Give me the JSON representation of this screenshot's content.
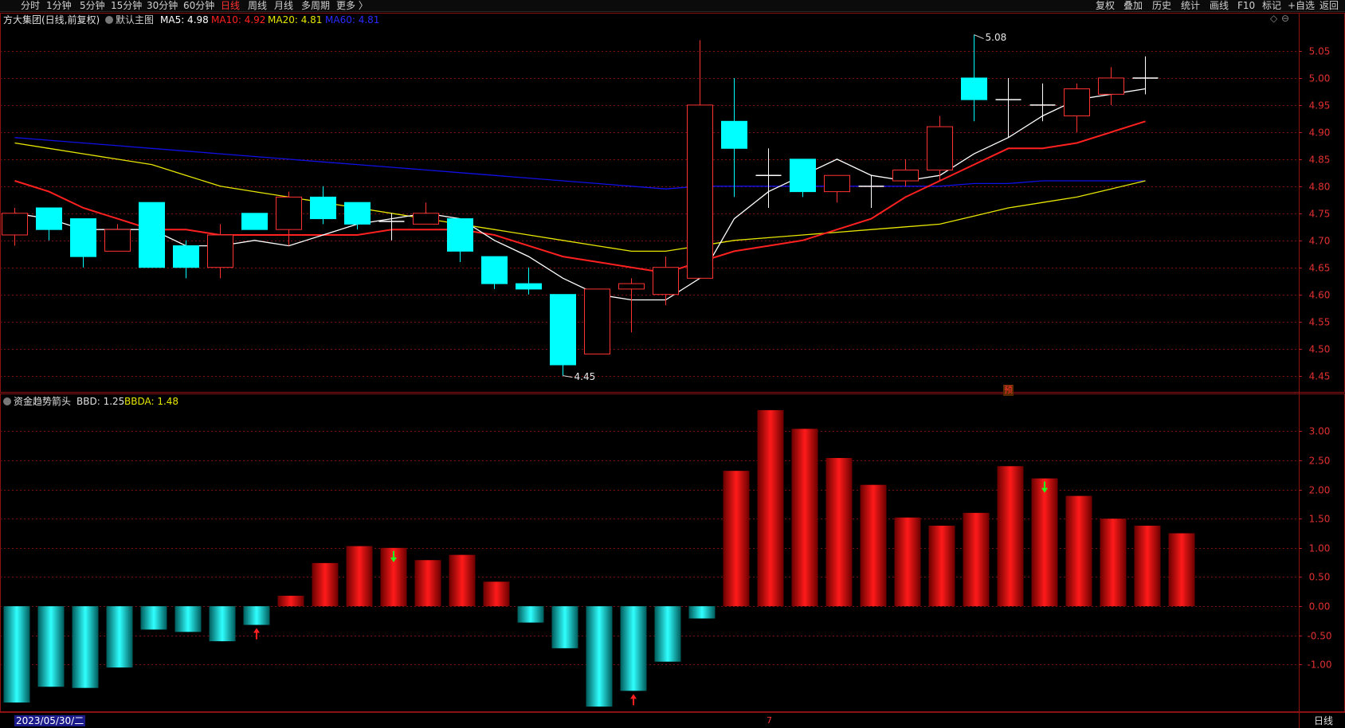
{
  "toolbar": {
    "periods": [
      "分时",
      "1分钟",
      "5分钟",
      "15分钟",
      "30分钟",
      "60分钟",
      "日线",
      "周线",
      "月线",
      "多周期",
      "更多 〉"
    ],
    "active_period": "日线",
    "right_items": [
      "复权",
      "叠加",
      "历史",
      "统计",
      "画线",
      "F10",
      "标记",
      "+自选",
      "返回"
    ]
  },
  "main_panel": {
    "stock_title": "方大集团(日线,前复权)",
    "template_label": "默认主图",
    "ma5_label": "MA5: 4.98",
    "ma10_label": "MA10: 4.92",
    "ma20_label": "MA20: 4.81",
    "ma60_label": "MA60: 4.81",
    "high_marker": "5.08",
    "low_marker": "4.45",
    "pre_marker": "预"
  },
  "sub_panel": {
    "indicator_name": "资金趋势箭头",
    "bbd_label": "BBD: 1.25",
    "bbda_label": "BBDA: 1.48"
  },
  "status": {
    "date_label": "2023/05/30/二",
    "month_marker": "7",
    "period_label": "日线"
  },
  "colors": {
    "up": "#ff3232",
    "down": "#00ffff",
    "ma5": "#ffffff",
    "ma10": "#ff2020",
    "ma20": "#e6e600",
    "ma60": "#1010e6",
    "grid": "#7a1010",
    "bar_up": "#e00000",
    "bar_down": "#00c8c8"
  },
  "chart_data": [
    {
      "type": "candlestick",
      "y_ticks": [
        "5.05",
        "5.00",
        "4.95",
        "4.90",
        "4.85",
        "4.80",
        "4.75",
        "4.70",
        "4.65",
        "4.60",
        "4.55",
        "4.50",
        "4.45"
      ],
      "ylim": [
        4.42,
        5.1
      ],
      "candles": [
        {
          "o": 4.71,
          "c": 4.75,
          "h": 4.76,
          "l": 4.69
        },
        {
          "o": 4.76,
          "c": 4.72,
          "h": 4.76,
          "l": 4.7
        },
        {
          "o": 4.74,
          "c": 4.67,
          "h": 4.74,
          "l": 4.65
        },
        {
          "o": 4.68,
          "c": 4.72,
          "h": 4.73,
          "l": 4.68
        },
        {
          "o": 4.77,
          "c": 4.65,
          "h": 4.77,
          "l": 4.65
        },
        {
          "o": 4.69,
          "c": 4.65,
          "h": 4.7,
          "l": 4.63
        },
        {
          "o": 4.65,
          "c": 4.71,
          "h": 4.73,
          "l": 4.63
        },
        {
          "o": 4.75,
          "c": 4.72,
          "h": 4.75,
          "l": 4.72
        },
        {
          "o": 4.72,
          "c": 4.78,
          "h": 4.79,
          "l": 4.69
        },
        {
          "o": 4.78,
          "c": 4.74,
          "h": 4.8,
          "l": 4.73
        },
        {
          "o": 4.77,
          "c": 4.73,
          "h": 4.77,
          "l": 4.72
        },
        {
          "o": 4.735,
          "c": 4.735,
          "h": 4.75,
          "l": 4.7
        },
        {
          "o": 4.73,
          "c": 4.75,
          "h": 4.77,
          "l": 4.73
        },
        {
          "o": 4.74,
          "c": 4.68,
          "h": 4.74,
          "l": 4.66
        },
        {
          "o": 4.67,
          "c": 4.62,
          "h": 4.67,
          "l": 4.61
        },
        {
          "o": 4.62,
          "c": 4.61,
          "h": 4.65,
          "l": 4.6
        },
        {
          "o": 4.6,
          "c": 4.47,
          "h": 4.6,
          "l": 4.45
        },
        {
          "o": 4.49,
          "c": 4.61,
          "h": 4.61,
          "l": 4.49
        },
        {
          "o": 4.61,
          "c": 4.62,
          "h": 4.63,
          "l": 4.53
        },
        {
          "o": 4.6,
          "c": 4.65,
          "h": 4.67,
          "l": 4.58
        },
        {
          "o": 4.63,
          "c": 4.95,
          "h": 5.07,
          "l": 4.63
        },
        {
          "o": 4.92,
          "c": 4.87,
          "h": 5.0,
          "l": 4.78
        },
        {
          "o": 4.82,
          "c": 4.82,
          "h": 4.87,
          "l": 4.76
        },
        {
          "o": 4.85,
          "c": 4.79,
          "h": 4.85,
          "l": 4.78
        },
        {
          "o": 4.79,
          "c": 4.82,
          "h": 4.82,
          "l": 4.77
        },
        {
          "o": 4.8,
          "c": 4.8,
          "h": 4.82,
          "l": 4.76
        },
        {
          "o": 4.81,
          "c": 4.83,
          "h": 4.85,
          "l": 4.8
        },
        {
          "o": 4.83,
          "c": 4.91,
          "h": 4.93,
          "l": 4.81
        },
        {
          "o": 5.0,
          "c": 4.96,
          "h": 5.08,
          "l": 4.92
        },
        {
          "o": 4.96,
          "c": 4.96,
          "h": 5.0,
          "l": 4.89
        },
        {
          "o": 4.95,
          "c": 4.95,
          "h": 4.99,
          "l": 4.92
        },
        {
          "o": 4.93,
          "c": 4.98,
          "h": 4.99,
          "l": 4.9
        },
        {
          "o": 4.97,
          "c": 5.0,
          "h": 5.02,
          "l": 4.95
        },
        {
          "o": 5.0,
          "c": 5.0,
          "h": 5.04,
          "l": 4.97
        }
      ],
      "ma5": [
        4.75,
        4.74,
        4.72,
        4.72,
        4.72,
        4.69,
        4.69,
        4.7,
        4.69,
        4.71,
        4.73,
        4.74,
        4.75,
        4.74,
        4.7,
        4.67,
        4.63,
        4.6,
        4.59,
        4.59,
        4.63,
        4.74,
        4.79,
        4.82,
        4.85,
        4.82,
        4.81,
        4.82,
        4.86,
        4.89,
        4.93,
        4.96,
        4.97,
        4.98
      ],
      "ma10": [
        4.81,
        4.79,
        4.76,
        4.74,
        4.72,
        4.72,
        4.71,
        4.71,
        4.71,
        4.71,
        4.71,
        4.72,
        4.72,
        4.72,
        4.71,
        4.69,
        4.67,
        4.66,
        4.65,
        4.64,
        4.66,
        4.68,
        4.69,
        4.7,
        4.72,
        4.74,
        4.78,
        4.81,
        4.84,
        4.87,
        4.87,
        4.88,
        4.9,
        4.92
      ],
      "ma20": [
        4.88,
        4.87,
        4.86,
        4.85,
        4.84,
        4.82,
        4.8,
        4.79,
        4.78,
        4.77,
        4.76,
        4.75,
        4.74,
        4.73,
        4.72,
        4.71,
        4.7,
        4.69,
        4.68,
        4.68,
        4.69,
        4.7,
        4.705,
        4.71,
        4.715,
        4.72,
        4.725,
        4.73,
        4.745,
        4.76,
        4.77,
        4.78,
        4.795,
        4.81
      ],
      "ma60": [
        4.89,
        4.885,
        4.88,
        4.875,
        4.87,
        4.865,
        4.86,
        4.855,
        4.85,
        4.845,
        4.84,
        4.835,
        4.83,
        4.825,
        4.82,
        4.815,
        4.81,
        4.805,
        4.8,
        4.795,
        4.8,
        4.8,
        4.8,
        4.8,
        4.8,
        4.8,
        4.8,
        4.8,
        4.805,
        4.805,
        4.81,
        4.81,
        4.81,
        4.81
      ]
    },
    {
      "type": "bar",
      "name": "资金趋势箭头",
      "y_ticks": [
        "3.00",
        "2.50",
        "2.00",
        "1.50",
        "1.00",
        "0.50",
        "0.00",
        "-0.50",
        "-1.00"
      ],
      "ylim": [
        -1.8,
        3.4
      ],
      "values": [
        -1.65,
        -1.38,
        -1.4,
        -1.05,
        -0.4,
        -0.44,
        -0.6,
        -0.32,
        0.18,
        0.74,
        1.03,
        1.0,
        0.79,
        0.88,
        0.42,
        -0.28,
        -0.72,
        -1.72,
        -1.45,
        -0.95,
        -0.21,
        2.32,
        3.36,
        3.04,
        2.54,
        2.08,
        1.52,
        1.38,
        1.6,
        2.4,
        2.19,
        1.89,
        1.5,
        1.38,
        1.25
      ],
      "arrows": [
        {
          "index": 7,
          "dir": "up"
        },
        {
          "index": 11,
          "dir": "down"
        },
        {
          "index": 18,
          "dir": "up"
        },
        {
          "index": 30,
          "dir": "down"
        }
      ]
    }
  ]
}
